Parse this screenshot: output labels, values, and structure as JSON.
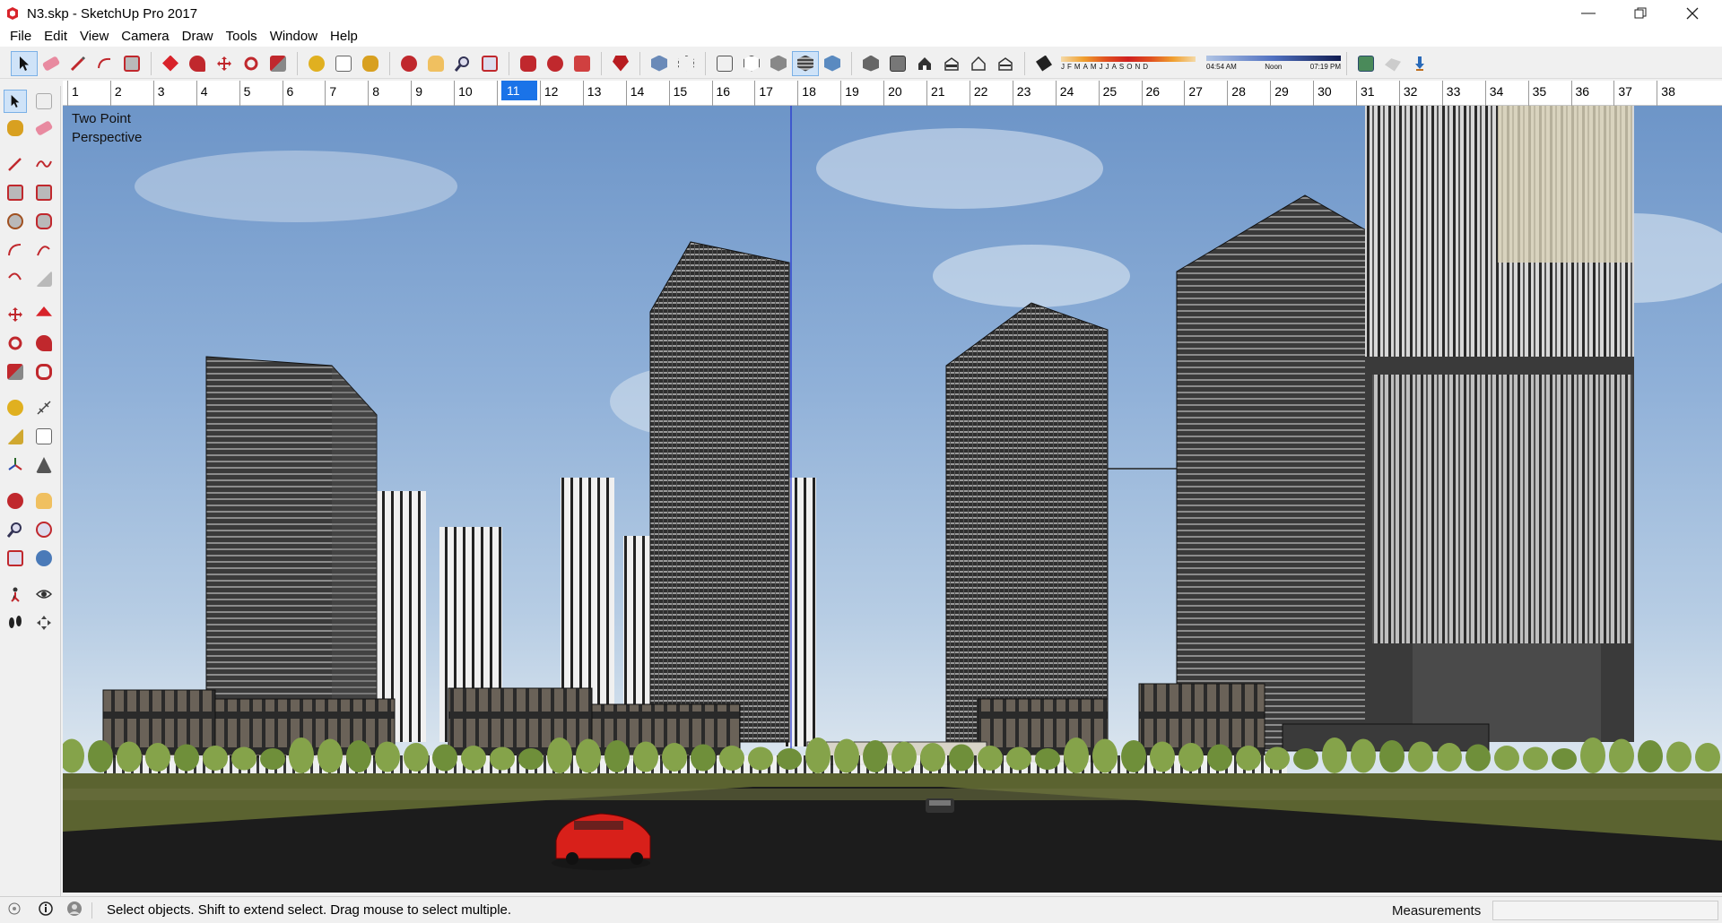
{
  "window": {
    "title": "N3.skp - SketchUp Pro 2017",
    "controls": [
      "minimize",
      "restore",
      "close"
    ]
  },
  "menu": [
    "File",
    "Edit",
    "View",
    "Camera",
    "Draw",
    "Tools",
    "Window",
    "Help"
  ],
  "toolbar": {
    "months": [
      "J",
      "F",
      "M",
      "A",
      "M",
      "J",
      "J",
      "A",
      "S",
      "O",
      "N",
      "D"
    ],
    "time_start": "04:54 AM",
    "time_noon": "Noon",
    "time_end": "07:19 PM"
  },
  "ruler": {
    "labels": [
      "1",
      "2",
      "3",
      "4",
      "5",
      "6",
      "7",
      "8",
      "9",
      "10",
      "11",
      "12",
      "13",
      "14",
      "15",
      "16",
      "17",
      "18",
      "19",
      "20",
      "21",
      "22",
      "23",
      "24",
      "25",
      "26",
      "27",
      "28",
      "29",
      "30",
      "31",
      "32",
      "33",
      "34",
      "35",
      "36",
      "37",
      "38"
    ],
    "active": "11"
  },
  "viewport": {
    "camera_mode_line1": "Two Point",
    "camera_mode_line2": "Perspective"
  },
  "status": {
    "message": "Select objects. Shift to extend select. Drag mouse to select multiple.",
    "measurements_label": "Measurements",
    "measurements_value": ""
  },
  "colors": {
    "accent": "#1a73e8",
    "sky_top": "#6d95c8",
    "ground": "#5b6330",
    "road": "#1c1c1c"
  }
}
